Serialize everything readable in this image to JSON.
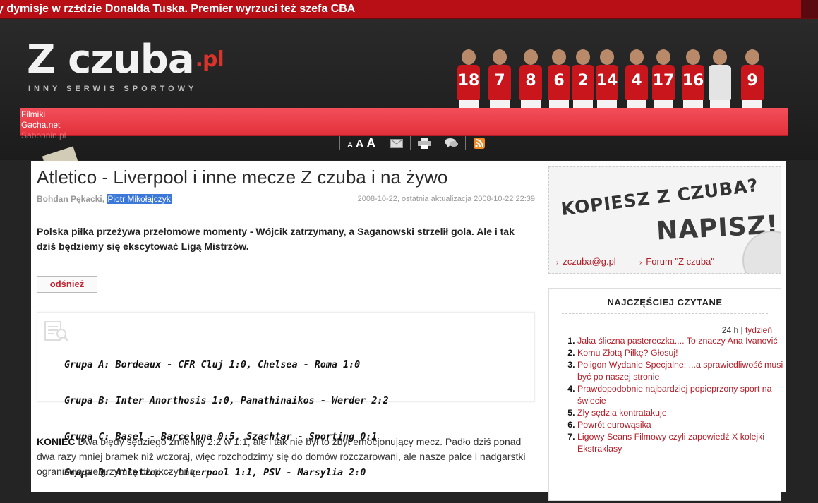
{
  "ticker": {
    "text": "y dymisje w rz±dzie Donalda Tuska. Premier wyrzuci też szefa CBA"
  },
  "header": {
    "logo_main": "Z czuba",
    "logo_suffix": ".pl",
    "tagline": "INNY SERWIS SPORTOWY",
    "player_numbers": [
      "18",
      "7",
      "8",
      "6",
      "2",
      "14",
      "4",
      "17",
      "16",
      "",
      "9"
    ],
    "links": [
      "Filmiki",
      "Gacha.net",
      "Sabonnin.pl"
    ]
  },
  "toolbar": {
    "font_small": "A",
    "font_medium": "A",
    "font_large": "A"
  },
  "article": {
    "title": "Atletico - Liverpool i inne mecze Z czuba i na żywo",
    "author1": "Bohdan Pękacki,",
    "author2": "Piotr Mikołajczyk",
    "dates": "2008-10-22, ostatnia aktualizacja 2008-10-22 22:39",
    "lead": "Polska piłka przeżywa przełomowe momenty - Wójcik zatrzymany, a Saganowski strzelił gola. Ale i tak dziś będziemy się ekscytować Ligą Mistrzów.",
    "refresh_label": "odśnież",
    "groups": [
      "Grupa A: Bordeaux - CFR Cluj 1:0, Chelsea - Roma 1:0",
      "Grupa B: Inter Anorthosis 1:0, Panathinaikos - Werder 2:2",
      "Grupa C: Basel - Barcelona 0:5, Szachtar - Sporting 0:1",
      "Grupa D: Atletico - Liverpool 1:1, PSV - Marsylia 2:0"
    ],
    "body_bold": "KONIEC",
    "body_text": " Dwa błędy sędziego zmieniły 2:2 w 1:1, ale i tak nie był to zbyt emocjonujący mecz. Padło dziś ponad dwa razy mniej bramek niż wczoraj, więc rozchodzimy się do domów rozczarowani, ale nasze palce i nadgarstki ograniżują pielgrzymkę dziękczynną."
  },
  "sidebar": {
    "ad_line1": "KOPIESZ Z CZUBA?",
    "ad_line2": "NAPISZ!",
    "ad_link1": "zczuba@g.pl",
    "ad_link2": "Forum \"Z czuba\"",
    "popular_title": "NAJCZĘŚCIEJ CZYTANE",
    "tab_24h": "24 h",
    "tab_sep": "|",
    "tab_week": "tydzień",
    "popular_items": [
      "Jaka śliczna pastereczka.... To znaczy Ana Ivanović",
      "Komu Złotą Piłkę? Głosuj!",
      "Poligon Wydanie Specjalne: ...a sprawiedliwość musi być po naszej stronie",
      "Prawdopodobnie najbardziej popieprzony sport na świecie",
      "Zły sędzia kontratakuje",
      "Powrót eurowąsika",
      "Ligowy Seans Filmowy czyli zapowiedź X kolejki Ekstraklasy"
    ]
  },
  "colors": {
    "accent": "#b31e28",
    "ticker_bg": "#b80f17",
    "header_bg": "#242424"
  }
}
